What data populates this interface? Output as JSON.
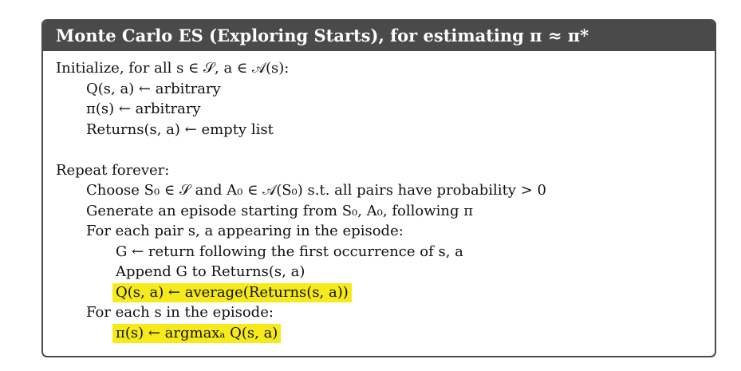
{
  "header": {
    "title": "Monte Carlo ES (Exploring Starts), for estimating π ≈ π*"
  },
  "init": {
    "heading": "Initialize, for all s ∈ 𝒮, a ∈ 𝒜(s):",
    "q": "Q(s, a) ← arbitrary",
    "pi": "π(s) ← arbitrary",
    "returns": "Returns(s, a) ← empty list"
  },
  "loop": {
    "heading": "Repeat forever:",
    "choose": "Choose S₀ ∈ 𝒮 and A₀ ∈ 𝒜(S₀) s.t. all pairs have probability > 0",
    "generate": "Generate an episode starting from S₀, A₀, following π",
    "for_pair": "For each pair s, a appearing in the episode:",
    "g_assign": "G ← return following the first occurrence of s, a",
    "append": "Append G to Returns(s, a)",
    "q_update": "Q(s, a) ← average(Returns(s, a))",
    "for_state": "For each s in the episode:",
    "pi_update": "π(s) ← argmaxₐ Q(s, a)"
  },
  "highlight_color": "#f6ea1a",
  "header_color": "#4a4a4a"
}
